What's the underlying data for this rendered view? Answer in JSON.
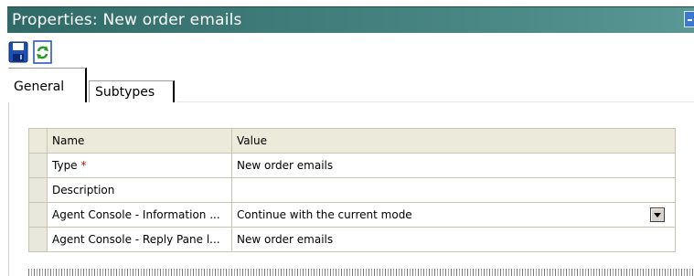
{
  "window": {
    "title": "Properties: New order emails"
  },
  "toolbar": {
    "save_icon": "floppy-disk-icon",
    "refresh_icon": "refresh-icon"
  },
  "tabs": [
    {
      "label": "General",
      "active": true
    },
    {
      "label": "Subtypes",
      "active": false
    }
  ],
  "grid": {
    "columns": [
      "Name",
      "Value"
    ],
    "rows": [
      {
        "name": "Type",
        "required_marker": "*",
        "value": "New order emails"
      },
      {
        "name": "Description",
        "value": ""
      },
      {
        "name": "Agent Console - Information ...",
        "value": "Continue with the current mode",
        "has_dropdown": true
      },
      {
        "name": "Agent Console - Reply Pane l...",
        "value": "New order emails"
      }
    ]
  },
  "colors": {
    "titlebar": "#3f7b78",
    "grid_header": "#eceadb",
    "required": "#e00000"
  }
}
